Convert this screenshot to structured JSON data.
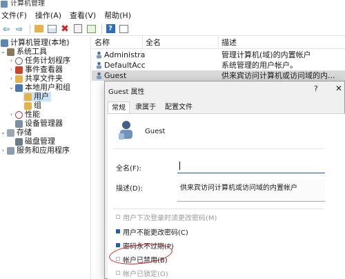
{
  "window": {
    "title": "计算机管理"
  },
  "menu": [
    "文件(F)",
    "操作(A)",
    "查看(V)",
    "帮助(H)"
  ],
  "toolbar": {
    "buttons": [
      "back-icon",
      "forward-icon",
      "up-folder-icon",
      "show-hide-tree-icon",
      "delete-icon",
      "properties-icon",
      "export-list-icon",
      "help-icon",
      "view-icon"
    ]
  },
  "tree": {
    "items": [
      {
        "label": "计算机管理(本地)",
        "icon": "computer-icon",
        "expanded": true
      },
      {
        "label": "系统工具",
        "icon": "tools-icon",
        "expanded": true
      },
      {
        "label": "任务计划程序",
        "icon": "clock-icon",
        "expanded": false
      },
      {
        "label": "事件查看器",
        "icon": "event-viewer-icon",
        "expanded": false
      },
      {
        "label": "共享文件夹",
        "icon": "shared-folder-icon",
        "expanded": false
      },
      {
        "label": "本地用户和组",
        "icon": "users-icon",
        "expanded": true
      },
      {
        "label": "用户",
        "icon": "folder-icon",
        "selected": true
      },
      {
        "label": "组",
        "icon": "folder-icon"
      },
      {
        "label": "性能",
        "icon": "performance-icon",
        "expanded": false
      },
      {
        "label": "设备管理器",
        "icon": "device-manager-icon"
      },
      {
        "label": "存储",
        "icon": "storage-icon",
        "expanded": true
      },
      {
        "label": "磁盘管理",
        "icon": "disk-icon"
      },
      {
        "label": "服务和应用程序",
        "icon": "services-icon",
        "expanded": false
      }
    ]
  },
  "list": {
    "columns": [
      "名称",
      "全名",
      "描述"
    ],
    "rows": [
      {
        "name": "Administrator",
        "fullname": "",
        "description": "管理计算机(域)的内置帐户"
      },
      {
        "name": "DefaultAcco...",
        "fullname": "",
        "description": "系统管理的用户帐户。"
      },
      {
        "name": "Guest",
        "fullname": "",
        "description": "供来宾访问计算机或访问域的内...",
        "selected": true
      }
    ]
  },
  "dialog": {
    "title": "Guest 属性",
    "help": "?",
    "close": "✕",
    "tabs": [
      "常规",
      "隶属于",
      "配置文件"
    ],
    "active_tab": 0,
    "username": "Guest",
    "fullname_label": "全名(F):",
    "fullname_value": "",
    "description_label": "描述(D):",
    "description_value": "供来宾访问计算机或访问域的内置帐户",
    "options": [
      {
        "label": "用户下次登录时须更改密码(M)",
        "checked": false,
        "disabled": true
      },
      {
        "label": "用户不能更改密码(C)",
        "checked": true,
        "disabled": false
      },
      {
        "label": "密码永不过期(P)",
        "checked": true,
        "disabled": false
      },
      {
        "label": "帐户已禁用(B)",
        "checked": false,
        "disabled": false
      },
      {
        "label": "帐户已锁定(O)",
        "checked": false,
        "disabled": true
      }
    ]
  },
  "colors": {
    "selection": "#cce4f7",
    "annotation": "#d62020",
    "accent": "#1f5fb3"
  }
}
